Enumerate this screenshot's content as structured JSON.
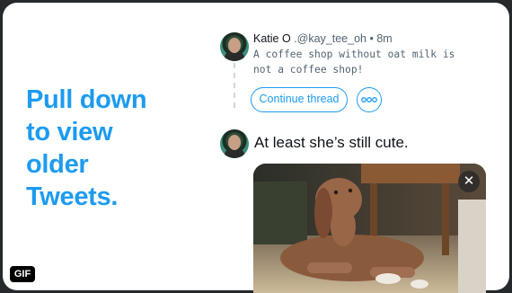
{
  "promo": {
    "lines": [
      "Pull down",
      "to view",
      "older",
      "Tweets."
    ]
  },
  "thread": {
    "author_name": "Katie O",
    "handle": ".@kay_tee_oh",
    "time": "8m",
    "separator": "•",
    "text": "A coffee shop without oat milk is not a coffee shop!",
    "continue_label": "Continue thread",
    "more_icon": "more-horizontal-icon"
  },
  "reply": {
    "text": "At least she’s still cute.",
    "media_description_icon": "dog-photo",
    "close_icon": "close-icon",
    "close_glyph": "✕"
  },
  "badge": {
    "label": "GIF"
  },
  "colors": {
    "accent": "#1d9bf0",
    "text_primary": "#0f1419",
    "text_secondary": "#536471",
    "frame": "#26292c"
  }
}
